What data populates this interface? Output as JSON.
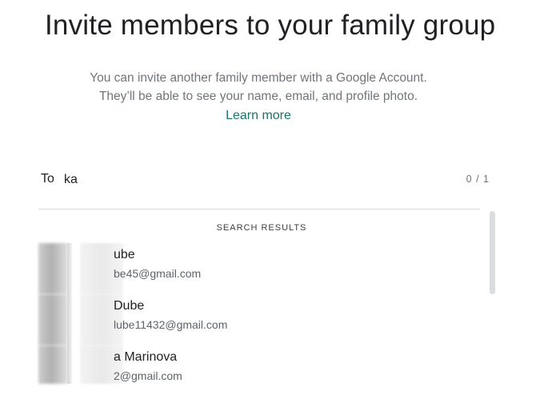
{
  "header": {
    "title": "Invite members to your family group",
    "subtitle_line1": "You can invite another family member with a Google Account.",
    "subtitle_line2": "They’ll be able to see your name, email, and profile photo.",
    "learn_more": "Learn more"
  },
  "to_field": {
    "label": "To",
    "value": "ka",
    "counter": "0 / 1"
  },
  "results": {
    "header": "SEARCH RESULTS",
    "items": [
      {
        "name": "ube",
        "email": "be45@gmail.com"
      },
      {
        "name": " Dube",
        "email": "lube11432@gmail.com"
      },
      {
        "name": "a Marinova",
        "email": "2@gmail.com"
      }
    ]
  },
  "colors": {
    "link": "#1a7367",
    "text": "#202124",
    "muted": "#70757a",
    "divider": "#dadce0"
  }
}
